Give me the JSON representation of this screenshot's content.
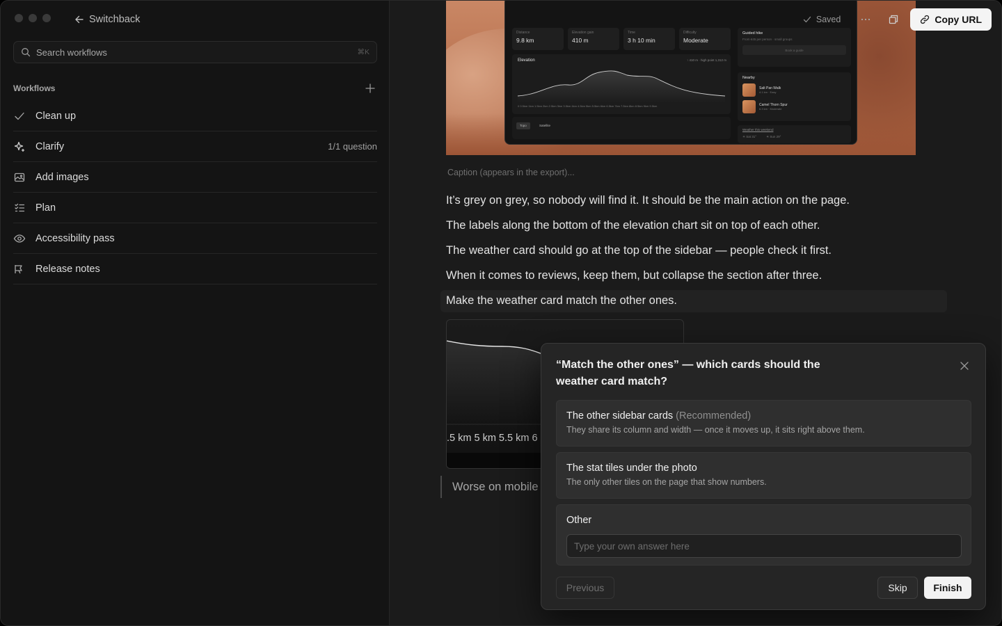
{
  "sidebar": {
    "back_label": "Switchback",
    "search": {
      "placeholder": "Search workflows",
      "shortcut": "⌘K"
    },
    "workflows_title": "Workflows",
    "items": [
      {
        "label": "Clean up",
        "icon": "check-icon",
        "meta": ""
      },
      {
        "label": "Clarify",
        "icon": "sparkle-icon",
        "meta": "1/1 question"
      },
      {
        "label": "Add images",
        "icon": "images-icon",
        "meta": ""
      },
      {
        "label": "Plan",
        "icon": "checklist-icon",
        "meta": ""
      },
      {
        "label": "Accessibility pass",
        "icon": "eye-icon",
        "meta": ""
      },
      {
        "label": "Release notes",
        "icon": "megaphone-icon",
        "meta": ""
      }
    ]
  },
  "toolbar": {
    "saved_label": "Saved",
    "more_icon": "more-icon",
    "duplicate_icon": "duplicate-icon",
    "copy_label": "Copy URL"
  },
  "hero_mock": {
    "stats": [
      {
        "label": "Distance",
        "value": "9.8 km"
      },
      {
        "label": "Elevation gain",
        "value": "410 m"
      },
      {
        "label": "Time",
        "value": "3 h 10 min"
      },
      {
        "label": "Difficulty",
        "value": "Moderate"
      }
    ],
    "elevation_title": "Elevation",
    "elevation_range": "↑ 410 m · high point 1,312 m",
    "elevation_ticks": "0 0.5km 1km 1.5km 2km 2.5km 3km 3.5km 4km 4.5km 5km 5.5km 6km 6.5km 7km 7.5km 8km 8.5km 9km 9.5km",
    "tabs": [
      "Topo",
      "Satellite"
    ],
    "guided_title": "Guided hike",
    "guided_sub": "From €45 per person · small groups",
    "guided_button": "Book a guide",
    "nearby_title": "Nearby",
    "nearby": [
      {
        "name": "Salt Pan Walk",
        "detail": "4.1 km · Easy"
      },
      {
        "name": "Camel Thorn Spur",
        "detail": "6.3 km · Moderate"
      }
    ],
    "weather_title": "Weather this weekend",
    "weather": [
      "☀ Sat 31°",
      "☀ Sun 29°"
    ]
  },
  "document": {
    "caption": "Caption (appears in the export)...",
    "paragraphs": [
      "It’s grey on grey, so nobody will find it. It should be the main action on the page.",
      "The labels along the bottom of the elevation chart sit on top of each other.",
      "The weather card should go at the top of the sidebar — people check it first.",
      "When it comes to reviews, keep them, but collapse the section after three.",
      "Make the weather card match the other ones."
    ],
    "thumb_ticks": ".5 km  5 km  5.5 km  6",
    "quote": "Worse on mobile"
  },
  "dialog": {
    "question": "“Match the other ones” — which cards should the weather card match?",
    "options": [
      {
        "title": "The other sidebar cards",
        "tag": "(Recommended)",
        "description": "They share its column and width — once it moves up, it sits right above them."
      },
      {
        "title": "The stat tiles under the photo",
        "tag": "",
        "description": "The only other tiles on the page that show numbers."
      }
    ],
    "other_label": "Other",
    "other_placeholder": "Type your own answer here",
    "previous_label": "Previous",
    "skip_label": "Skip",
    "finish_label": "Finish"
  },
  "colors": {
    "background": "#1b1b1b",
    "sidebar": "#141414",
    "accent_button": "#f2f2f2",
    "dialog": "#252525"
  }
}
